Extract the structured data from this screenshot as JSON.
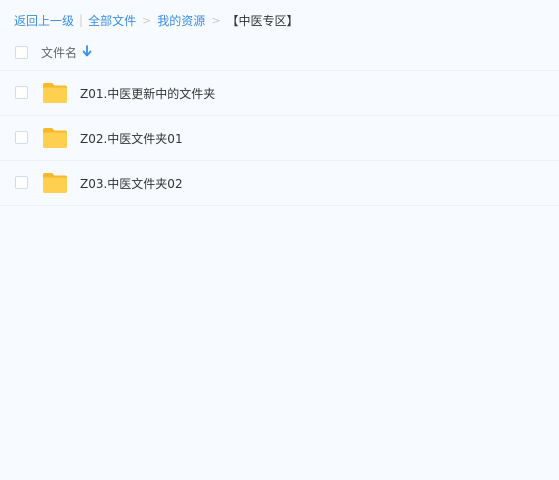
{
  "breadcrumb": {
    "back": "返回上一级",
    "all_files": "全部文件",
    "my_resources": "我的资源",
    "separator": ">",
    "current": "【中医专区】"
  },
  "header": {
    "column_name": "文件名",
    "sort_icon": "arrow-down-icon"
  },
  "files": [
    {
      "name": "Z01.中医更新中的文件夹",
      "icon": "folder-icon"
    },
    {
      "name": "Z02.中医文件夹01",
      "icon": "folder-icon"
    },
    {
      "name": "Z03.中医文件夹02",
      "icon": "folder-icon"
    }
  ],
  "colors": {
    "link": "#3a8ee6",
    "folder": "#ffd04f",
    "background": "#f7fbff"
  }
}
